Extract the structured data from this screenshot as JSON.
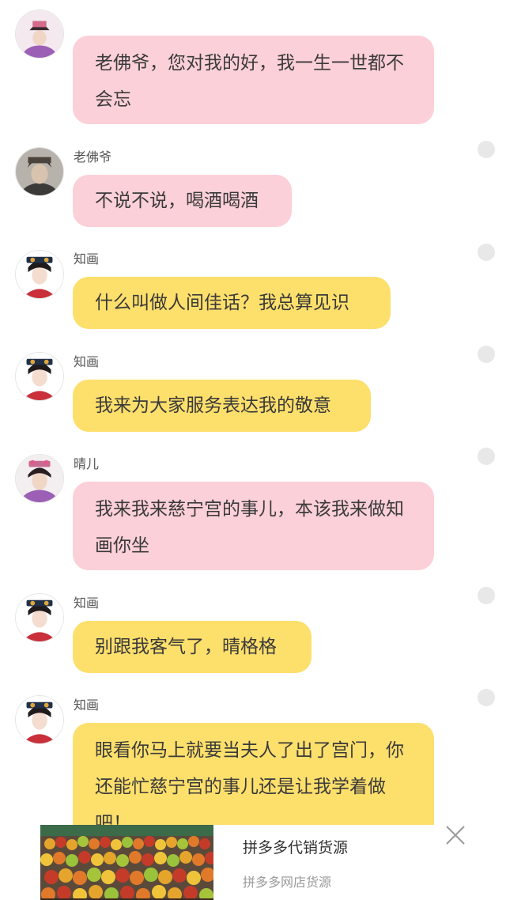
{
  "messages": [
    {
      "id": "m0",
      "sender": "晴儿",
      "show_name": false,
      "text": "老佛爷，您对我的好，我一生一世都不会忘",
      "color": "pink"
    },
    {
      "id": "m1",
      "sender": "老佛爷",
      "show_name": true,
      "text": "不说不说，喝酒喝酒",
      "color": "pink"
    },
    {
      "id": "m2",
      "sender": "知画",
      "show_name": true,
      "text": "什么叫做人间佳话？我总算见识",
      "color": "yellow"
    },
    {
      "id": "m3",
      "sender": "知画",
      "show_name": true,
      "text": "我来为大家服务表达我的敬意",
      "color": "yellow"
    },
    {
      "id": "m4",
      "sender": "晴儿",
      "show_name": true,
      "text": "我来我来慈宁宫的事儿，本该我来做知画你坐",
      "color": "pink"
    },
    {
      "id": "m5",
      "sender": "知画",
      "show_name": true,
      "text": "别跟我客气了，晴格格",
      "color": "yellow"
    },
    {
      "id": "m6",
      "sender": "知画",
      "show_name": true,
      "text": "眼看你马上就要当夫人了出了宫门，你还能忙慈宁宫的事儿还是让我学着做吧！",
      "color": "yellow"
    }
  ],
  "ad": {
    "title": "拼多多代销货源",
    "subtitle": "拼多多网店货源",
    "close_icon": "close-icon",
    "image_icon": "fruit-stand-image"
  },
  "colors": {
    "pink_bubble": "#fcd0d8",
    "yellow_bubble": "#fddf6c",
    "background": "#ffffff"
  }
}
